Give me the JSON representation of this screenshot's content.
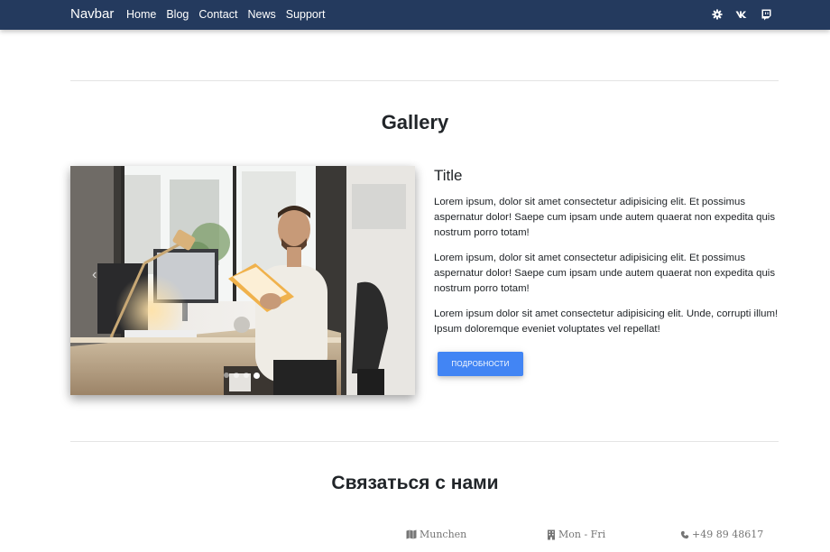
{
  "navbar": {
    "brand": "Navbar",
    "links": [
      "Home",
      "Blog",
      "Contact",
      "News",
      "Support"
    ],
    "social_icons": [
      "cog-icon",
      "vk-icon",
      "twitch-icon"
    ]
  },
  "gallery": {
    "heading": "Gallery",
    "image_description": "photo-man-reading-book-at-office-desk",
    "slide_count": 4,
    "active_slide": 4,
    "content": {
      "title": "Title",
      "paragraphs": [
        "Lorem ipsum, dolor sit amet consectetur adipisicing elit. Et possimus aspernatur dolor! Saepe cum ipsam unde autem quaerat non expedita quis nostrum porro totam!",
        "Lorem ipsum, dolor sit amet consectetur adipisicing elit. Et possimus aspernatur dolor! Saepe cum ipsam unde autem quaerat non expedita quis nostrum porro totam!",
        "Lorem ipsum dolor sit amet consectetur adipisicing elit. Unde, corrupti illum! Ipsum doloremque eveniet voluptates vel repellat!"
      ],
      "button_label": "ПОДРОБНОСТИ"
    }
  },
  "contact": {
    "heading": "Связаться с нами",
    "items": [
      {
        "icon": "map-icon",
        "text": "Munchen"
      },
      {
        "icon": "building-icon",
        "text": "Mon - Fri"
      },
      {
        "icon": "phone-icon",
        "text": "+49 89 48617"
      }
    ]
  },
  "colors": {
    "navbar_bg": "#243a5e",
    "accent": "#4285f4",
    "text": "#212529",
    "muted": "#757575"
  }
}
